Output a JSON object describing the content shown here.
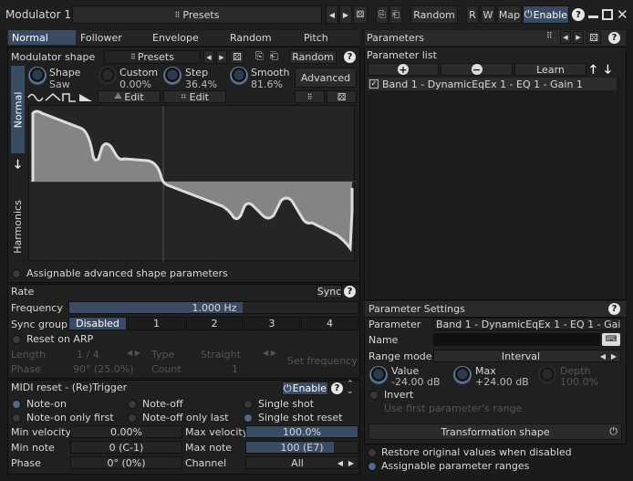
{
  "title": "Modulator 1",
  "topbar": {
    "presets": "Presets",
    "random": "Random",
    "r": "R",
    "w": "W",
    "map": "Map",
    "enable": "Enable",
    "help": "?"
  },
  "tabs": [
    "Normal",
    "Follower",
    "Envelope",
    "Random",
    "Pitch"
  ],
  "shape_panel": {
    "title": "Modulator shape",
    "presets": "Presets",
    "random": "Random",
    "advanced": "Advanced",
    "edit1": "Edit",
    "edit2": "Edit",
    "shape_label": "Shape",
    "shape_value": "Saw",
    "custom_label": "Custom",
    "custom_value": "0.00%",
    "step_label": "Step",
    "step_value": "36.4%",
    "smooth_label": "Smooth",
    "smooth_value": "81.6%",
    "side_normal": "Normal",
    "side_harmonics": "Harmonics",
    "assignable": "Assignable advanced shape parameters"
  },
  "rate": {
    "title": "Rate",
    "sync": "Sync",
    "frequency_label": "Frequency",
    "frequency_value": "1.000 Hz",
    "syncgroup_label": "Sync group",
    "syncgroup_options": [
      "Disabled",
      "1",
      "2",
      "3",
      "4"
    ],
    "reset_on_arp": "Reset on ARP",
    "length_label": "Length",
    "length_value": "1 / 4",
    "type_label": "Type",
    "type_value": "Straight",
    "phase_label": "Phase",
    "phase_value": "90° (25.0%)",
    "count_label": "Count",
    "count_value": "1",
    "set_frequency": "Set frequency"
  },
  "midi": {
    "title": "MIDI reset - (Re)Trigger",
    "enable": "Enable",
    "note_on": "Note-on",
    "note_off": "Note-off",
    "single_shot": "Single shot",
    "note_on_only_first": "Note-on only first",
    "note_off_only_last": "Note-off only last",
    "single_shot_reset": "Single shot reset",
    "min_velocity_label": "Min velocity",
    "min_velocity_value": "0.00%",
    "max_velocity_label": "Max velocity",
    "max_velocity_value": "100.0%",
    "max_velocity_fill": 1.0,
    "min_note_label": "Min note",
    "min_note_value": "0 (C-1)",
    "max_note_label": "Max note",
    "max_note_value": "100 (E7)",
    "max_note_fill": 0.79,
    "phase_label": "Phase",
    "phase_value": "0° (0%)",
    "channel_label": "Channel",
    "channel_value": "All"
  },
  "parameters": {
    "title": "Parameters",
    "list_title": "Parameter list",
    "learn": "Learn",
    "item": "Band 1 - DynamicEqEx 1 - EQ 1 - Gain 1"
  },
  "settings": {
    "title": "Parameter Settings",
    "parameter_label": "Parameter",
    "parameter_value": "Band 1 - DynamicEqEx 1 - EQ 1 - Gain 1",
    "name_label": "Name",
    "name_value": "",
    "range_mode_label": "Range mode",
    "range_mode_value": "Interval",
    "value_label": "Value",
    "value_value": "-24.00 dB",
    "max_label": "Max",
    "max_value": "+24.00 dB",
    "depth_label": "Depth",
    "depth_value": "100.0%",
    "invert": "Invert",
    "use_first": "Use first parameter's range",
    "transformation": "Transformation shape"
  },
  "bottom": {
    "restore": "Restore original values when disabled",
    "assignable": "Assignable parameter ranges"
  }
}
